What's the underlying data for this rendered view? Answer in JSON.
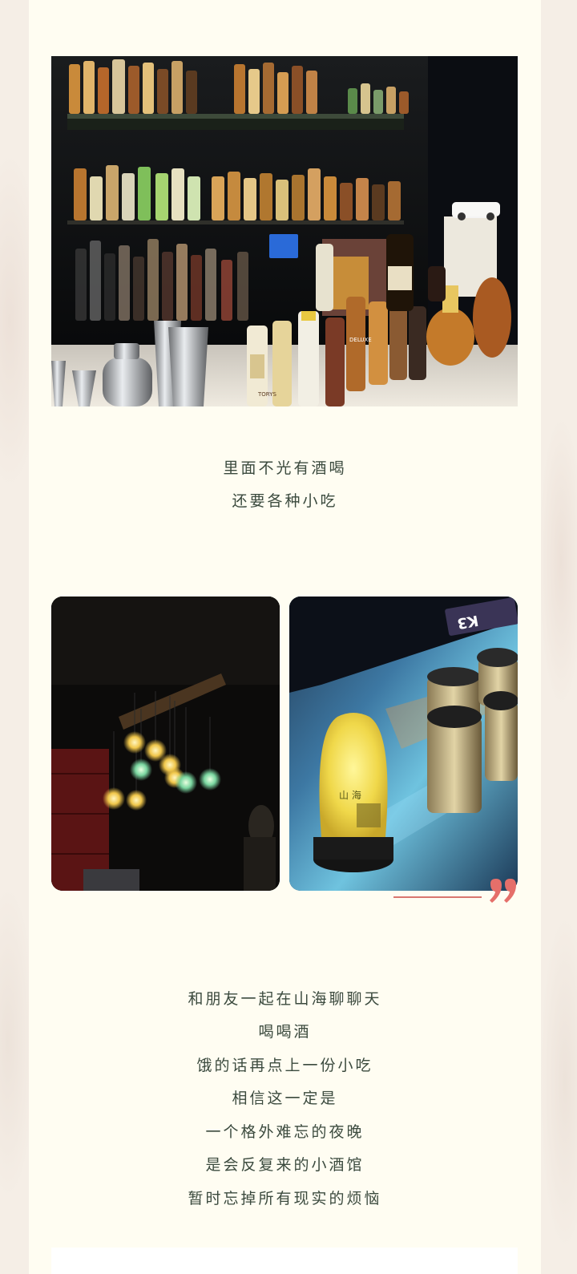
{
  "captions": {
    "first": [
      "里面不光有酒喝",
      "还要各种小吃"
    ],
    "second": [
      "和朋友一起在山海聊聊天",
      "喝喝酒",
      "饿的话再点上一份小吃",
      "相信这一定是",
      "一个格外难忘的夜晚",
      "是会反复来的小酒馆",
      "暂时忘掉所有现实的烦恼"
    ]
  },
  "photos": {
    "bar_label": "DELUXE",
    "bottle_label": "TORYS",
    "lamp_text": "山 海",
    "table_code": "K3"
  },
  "colors": {
    "card": "#fffdf2",
    "caption_text": "#3b4a3e",
    "accent": "#d9766f"
  }
}
